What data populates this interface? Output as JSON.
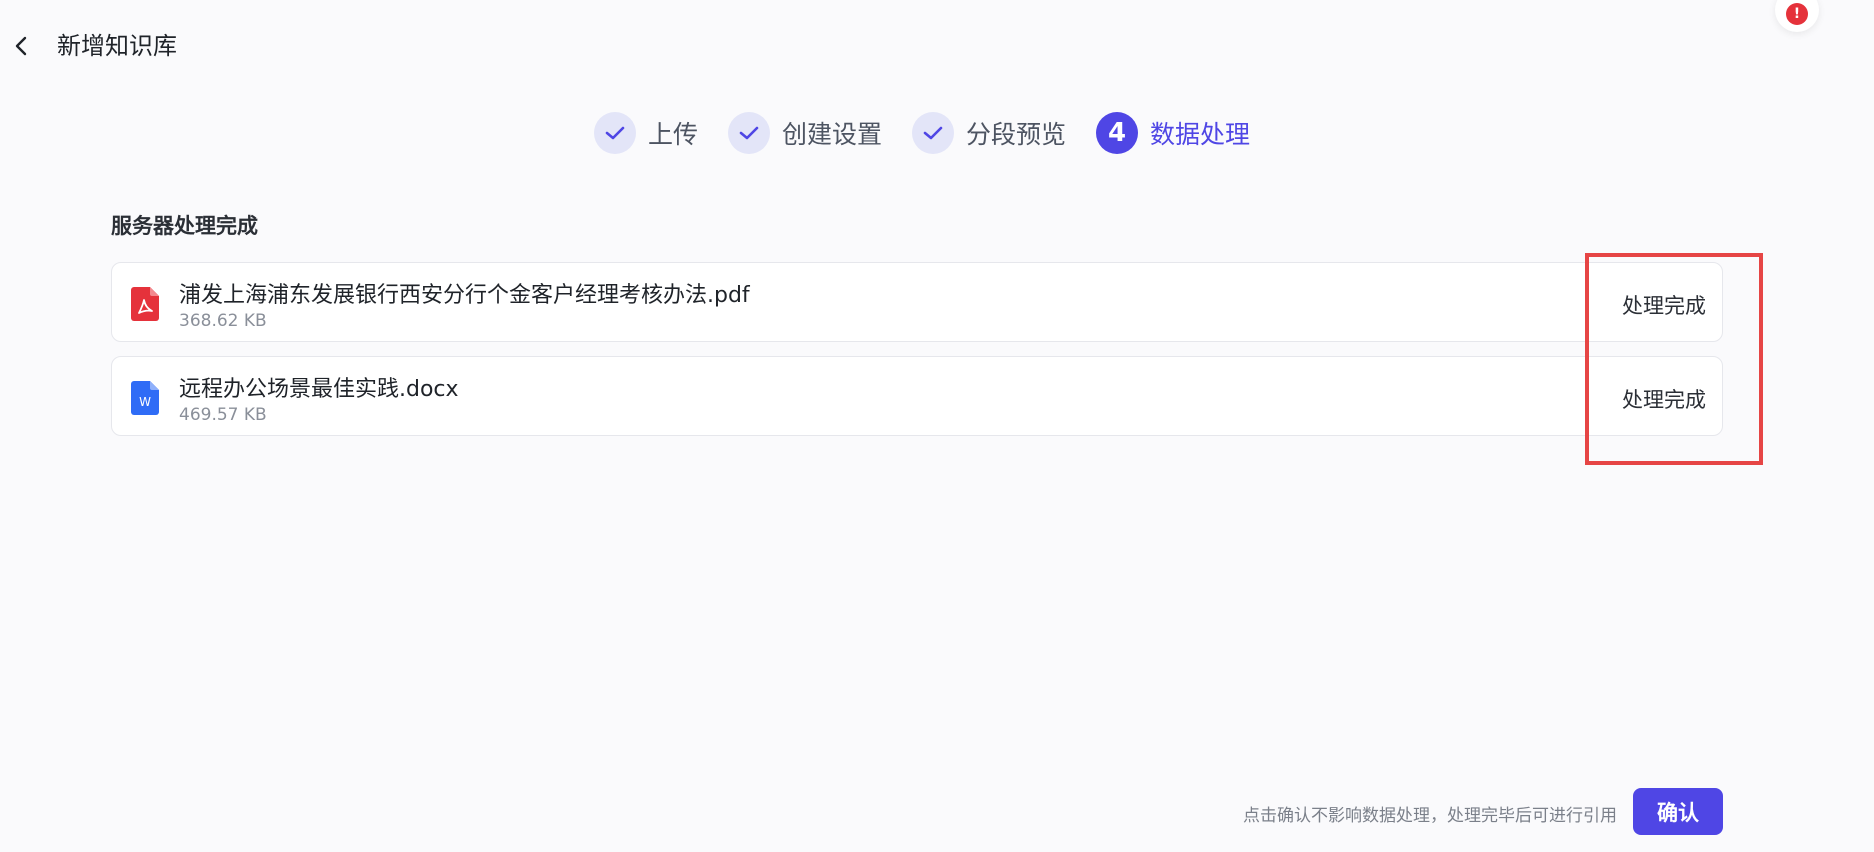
{
  "header": {
    "title": "新增知识库"
  },
  "steps": [
    {
      "label": "上传",
      "status": "done"
    },
    {
      "label": "创建设置",
      "status": "done"
    },
    {
      "label": "分段预览",
      "status": "done"
    },
    {
      "label": "数据处理",
      "status": "active",
      "number": "4"
    }
  ],
  "section": {
    "title": "服务器处理完成"
  },
  "files": [
    {
      "name": "浦发上海浦东发展银行西安分行个金客户经理考核办法.pdf",
      "size": "368.62 KB",
      "status": "处理完成",
      "icon": "pdf-file-icon"
    },
    {
      "name": "远程办公场景最佳实践.docx",
      "size": "469.57 KB",
      "status": "处理完成",
      "icon": "word-file-icon"
    }
  ],
  "footer": {
    "hint": "点击确认不影响数据处理，处理完毕后可进行引用",
    "confirm_label": "确认"
  },
  "alert": {
    "symbol": "!"
  },
  "colors": {
    "accent": "#4f46e5",
    "highlight": "#e64545",
    "pdf": "#e5323b",
    "word": "#2f6cf6"
  }
}
